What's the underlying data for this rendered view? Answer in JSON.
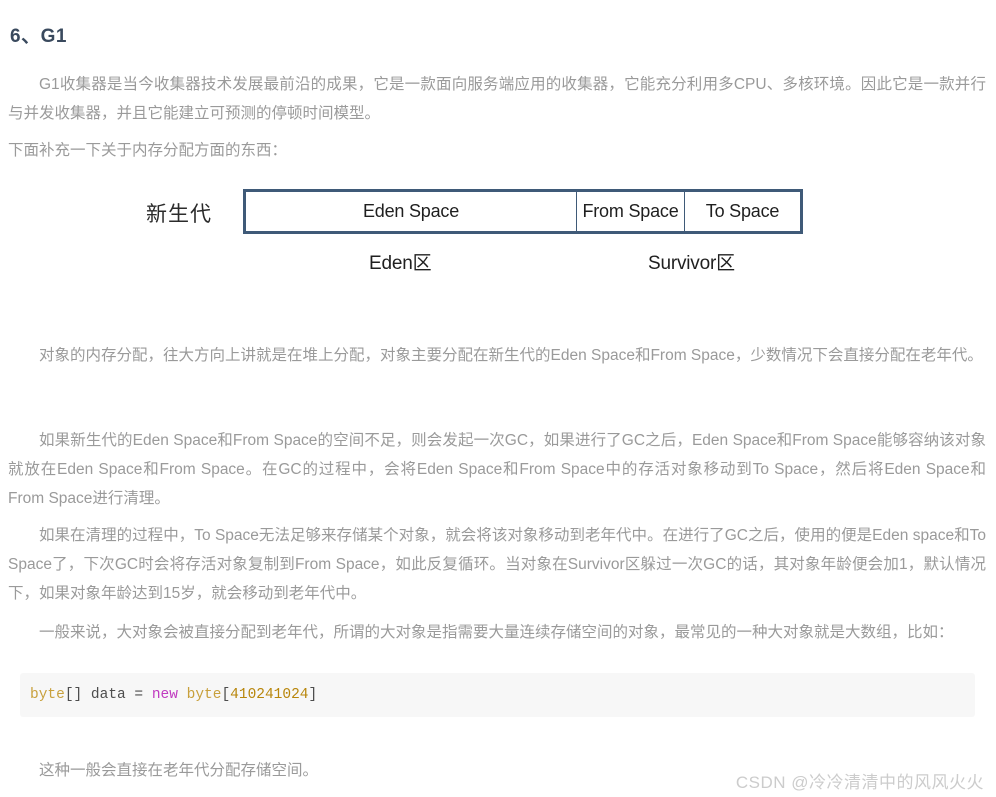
{
  "heading": "6、G1",
  "paragraphs": {
    "p1": "G1收集器是当今收集器技术发展最前沿的成果，它是一款面向服务端应用的收集器，它能充分利用多CPU、多核环境。因此它是一款并行与并发收集器，并且它能建立可预测的停顿时间模型。",
    "p2": "下面补充一下关于内存分配方面的东西：",
    "p3": "对象的内存分配，往大方向上讲就是在堆上分配，对象主要分配在新生代的Eden Space和From Space，少数情况下会直接分配在老年代。",
    "p4": "如果新生代的Eden Space和From Space的空间不足，则会发起一次GC，如果进行了GC之后，Eden Space和From Space能够容纳该对象就放在Eden Space和From Space。在GC的过程中，会将Eden Space和From Space中的存活对象移动到To Space，然后将Eden Space和From Space进行清理。",
    "p5": "如果在清理的过程中，To Space无法足够来存储某个对象，就会将该对象移动到老年代中。在进行了GC之后，使用的便是Eden space和To Space了，下次GC时会将存活对象复制到From Space，如此反复循环。当对象在Survivor区躲过一次GC的话，其对象年龄便会加1，默认情况下，如果对象年龄达到15岁，就会移动到老年代中。",
    "p6": "一般来说，大对象会被直接分配到老年代，所谓的大对象是指需要大量连续存储空间的对象，最常见的一种大对象就是大数组，比如：",
    "p7": "这种一般会直接在老年代分配存储空间。"
  },
  "diagram": {
    "left_label": "新生代",
    "cells": [
      {
        "label": "Eden Space"
      },
      {
        "label": "From Space"
      },
      {
        "label": "To Space"
      }
    ],
    "zone_labels": {
      "eden": "Eden区",
      "survivor": "Survivor区"
    },
    "border_color": "#3f5a78"
  },
  "code": {
    "language": "java",
    "tokens": [
      {
        "text": "byte",
        "type": "type"
      },
      {
        "text": "[] ",
        "type": "plain"
      },
      {
        "text": "data",
        "type": "ident"
      },
      {
        "text": " = ",
        "type": "plain"
      },
      {
        "text": "new",
        "type": "keyword"
      },
      {
        "text": " ",
        "type": "plain"
      },
      {
        "text": "byte",
        "type": "type"
      },
      {
        "text": "[",
        "type": "plain"
      },
      {
        "text": "410241024",
        "type": "number"
      },
      {
        "text": "]",
        "type": "plain"
      }
    ],
    "full_text": "byte[] data = new byte[410241024]",
    "background": "#f7f7f7"
  },
  "watermark": "CSDN @冷冷清清中的风风火火"
}
